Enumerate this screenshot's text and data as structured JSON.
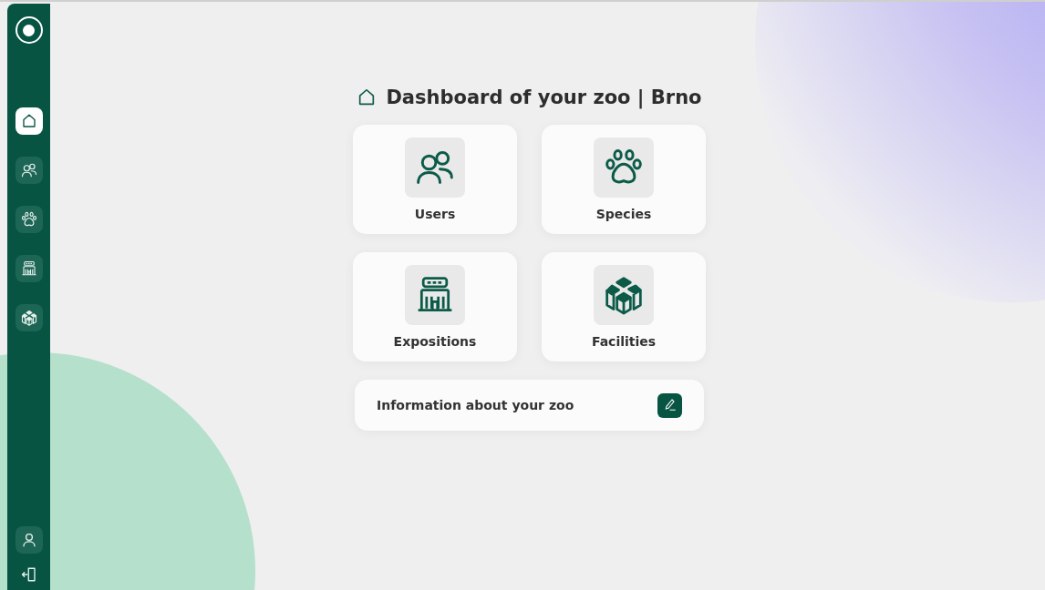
{
  "sidebar": {
    "items": [
      {
        "kind": "home",
        "selected": true
      },
      {
        "kind": "users",
        "selected": false
      },
      {
        "kind": "paw",
        "selected": false
      },
      {
        "kind": "zoo",
        "selected": false
      },
      {
        "kind": "boxes",
        "selected": false
      }
    ],
    "bottom_items": [
      {
        "kind": "user"
      },
      {
        "kind": "logout"
      }
    ]
  },
  "title": "Dashboard of your zoo | Brno",
  "cards": [
    {
      "label": "Users",
      "kind": "users"
    },
    {
      "label": "Species",
      "kind": "paw"
    },
    {
      "label": "Expositions",
      "kind": "zoo"
    },
    {
      "label": "Facilities",
      "kind": "boxes"
    }
  ],
  "info": {
    "label": "Information about your zoo"
  }
}
